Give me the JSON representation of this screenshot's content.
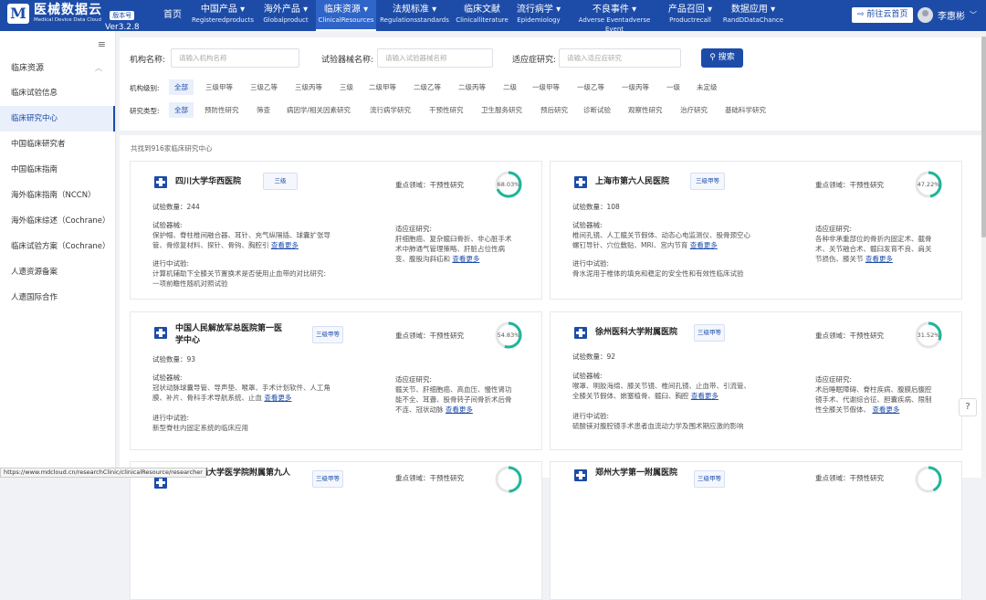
{
  "brand": {
    "logo_letter": "M",
    "name": "医械数据云",
    "subtitle": "Medical Device Data Cloud",
    "badge": "版本号",
    "version": "Ver3.2.8"
  },
  "nav": [
    {
      "cn": "首页",
      "en": ""
    },
    {
      "cn": "中国产品 ▾",
      "en": "Registeredproducts"
    },
    {
      "cn": "海外产品 ▾",
      "en": "Globalproduct"
    },
    {
      "cn": "临床资源 ▾",
      "en": "ClinicalResources"
    },
    {
      "cn": "法规标准 ▾",
      "en": "Regulationsstandards"
    },
    {
      "cn": "临床文献",
      "en": "Clinicalliterature"
    },
    {
      "cn": "流行病学 ▾",
      "en": "Epidemiology"
    },
    {
      "cn": "不良事件 ▾",
      "en": "Adverse Eventadverse Event"
    },
    {
      "cn": "产品召回 ▾",
      "en": "Productrecall"
    },
    {
      "cn": "数据应用 ▾",
      "en": "RandDDataChance"
    }
  ],
  "header": {
    "goto_label": "前往云首页",
    "user_name": "李惠彬"
  },
  "sidebar": {
    "collapse_icon": "≡",
    "group": "临床资源",
    "items": [
      "临床试验信息",
      "临床研究中心",
      "中国临床研究者",
      "中国临床指南",
      "海外临床指南（NCCN）",
      "海外临床综述（Cochrane）",
      "临床试验方案（Cochrane）",
      "人遗资源备案",
      "人遗国际合作"
    ]
  },
  "filter": {
    "inst_label": "机构名称:",
    "inst_placeholder": "请输入机构名称",
    "device_label": "试验器械名称:",
    "device_placeholder": "请输入试验器械名称",
    "indication_label": "适应症研究:",
    "indication_placeholder": "请输入适应症研究",
    "search_label": "搜索",
    "level_label": "机构级别:",
    "levels": [
      "全部",
      "三级甲等",
      "三级乙等",
      "三级丙等",
      "三级",
      "二级甲等",
      "二级乙等",
      "二级丙等",
      "二级",
      "一级甲等",
      "一级乙等",
      "一级丙等",
      "一级",
      "未定级"
    ],
    "type_label": "研究类型:",
    "types": [
      "全部",
      "预防性研究",
      "筛查",
      "病因学/相关因素研究",
      "流行病学研究",
      "干预性研究",
      "卫生服务研究",
      "预后研究",
      "诊断试验",
      "观察性研究",
      "治疗研究",
      "基础科学研究"
    ]
  },
  "results": {
    "count_text": "共找到916家临床研究中心"
  },
  "labels": {
    "trials": "试验数量：",
    "devices": "试验器械:",
    "ongoing": "进行中试验:",
    "focus": "重点领域：",
    "indications": "适应症研究:",
    "more": "查看更多"
  },
  "cards": [
    {
      "name": "四川大学华西医院",
      "level": "三级",
      "trials": "244",
      "focus": "干预性研究",
      "percent": "68.03%",
      "devices": [
        "保护帽、脊柱椎间融合器、耳针、充气纵隔插、球囊扩张导",
        "管、骨修复材料、探针、骨钩、胸腔引"
      ],
      "indications": [
        "肝细胞癌、复杂髋臼骨折、非心脏手术",
        "术中肺通气管理策略、肝脏占位性病",
        "变、腹股沟斜疝和"
      ],
      "ongoing": [
        "计算机辅助下全膝关节置换术是否使用止血带的对比研究:",
        "一项前瞻性随机对照试验"
      ]
    },
    {
      "name": "上海市第六人民医院",
      "level": "三级甲等",
      "trials": "108",
      "focus": "干预性研究",
      "percent": "47.22%",
      "devices": [
        "椎间孔镜、人工髋关节假体、动态心电监测仪、股骨颈空心",
        "螺钉导针、穴位敷贴、MRI、宫内节育"
      ],
      "indications": [
        "各种非承重部位的骨折内固定术、截骨",
        "术、关节融合术、髋臼发育不良、肩关",
        "节损伤、膝关节"
      ],
      "ongoing": [
        "骨水泥用于椎体的填充和稳定的安全性和有效性临床试验"
      ]
    },
    {
      "name": "中国人民解放军总医院第一医",
      "name2": "学中心",
      "level": "三级甲等",
      "trials": "93",
      "focus": "干预性研究",
      "percent": "54.83%",
      "devices": [
        "冠状动脉球囊导管、导声垫、喉罩、手术计划软件、人工角",
        "膜、补片、骨科手术导航系统、止血"
      ],
      "indications": [
        "髋关节、肝细胞癌、高血压、慢性肾功",
        "能不全、耳聋、股骨转子间骨折术后骨",
        "不连、冠状动脉"
      ],
      "ongoing": [
        "新型脊柱内固定系统的临床应用"
      ]
    },
    {
      "name": "徐州医科大学附属医院",
      "level": "三级甲等",
      "trials": "92",
      "focus": "干预性研究",
      "percent": "31.52%",
      "devices": [
        "喉罩、明胶海绵、膝关节镜、椎间孔镜、止血带、引流管、",
        "全膝关节假体、嵌塞植骨、髋臼、胸腔"
      ],
      "indications": [
        "术后睡眠障碍、脊柱疾病、腹膜后腹腔",
        "镜手术、代谢综合征、胆囊疾病、限制",
        "性全膝关节假体、"
      ],
      "ongoing": [
        "硫酸镁对腹腔镜手术患者血流动力学及围术期应激的影响"
      ]
    },
    {
      "name": "上海交通大学医学院附属第九人",
      "level": "三级甲等",
      "trials": "",
      "focus": "干预性研究",
      "percent": "",
      "devices": [],
      "indications": [],
      "ongoing": []
    },
    {
      "name": "郑州大学第一附属医院",
      "level": "三级甲等",
      "trials": "",
      "focus": "干预性研究",
      "percent": "",
      "devices": [],
      "indications": [],
      "ongoing": []
    }
  ],
  "status_url": "https://www.mdcloud.cn/researchClinic/clinicalResource/researcher",
  "help_icon": "?",
  "colors": {
    "primary": "#1d4ca8",
    "ring": "#1fb59a"
  }
}
